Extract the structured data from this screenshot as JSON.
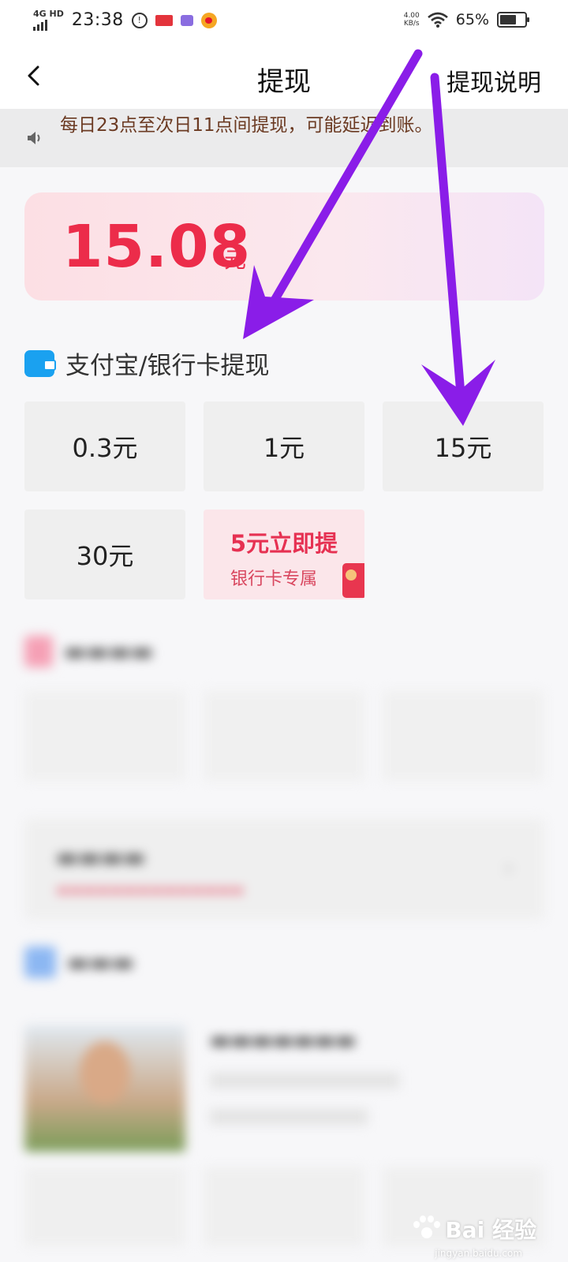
{
  "status_bar": {
    "network": "4G HD",
    "time": "23:38",
    "speed_value": "4.00",
    "speed_unit": "KB/s",
    "battery_percent": "65%",
    "battery_level": 0.65
  },
  "header": {
    "title": "提现",
    "right_link": "提现说明"
  },
  "notice": {
    "text": "每日23点至次日11点间提现，可能延迟到账。"
  },
  "balance": {
    "amount": "15.08",
    "unit": "元"
  },
  "withdraw_section": {
    "title": "支付宝/银行卡提现",
    "options": [
      "0.3元",
      "1元",
      "15元",
      "30元"
    ],
    "promo": {
      "title": "5元立即提",
      "subtitle": "银行卡专属"
    }
  },
  "colors": {
    "accent": "#ec2c4a",
    "arrow": "#8a1de8",
    "wallet": "#1aa1f0"
  },
  "watermark": {
    "text": "Bai 经验",
    "sub": "jingyan.baidu.com"
  }
}
